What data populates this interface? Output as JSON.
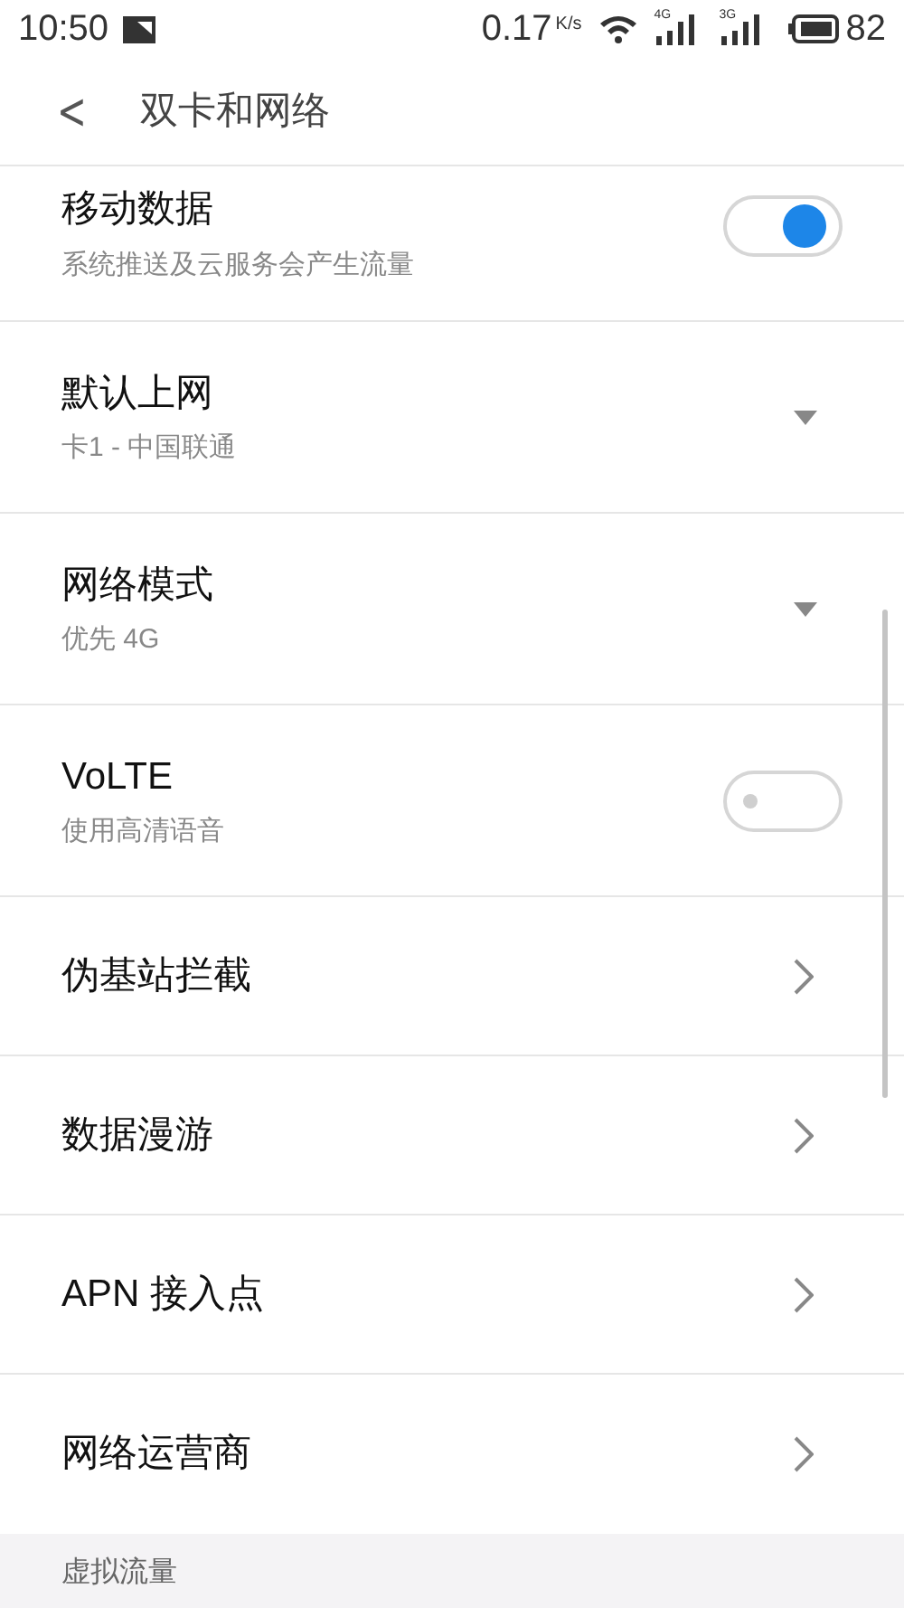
{
  "status_bar": {
    "time": "10:50",
    "speed": "0.17",
    "speed_unit": "K/s",
    "signals": [
      {
        "label": "4G"
      },
      {
        "label": "3G"
      }
    ],
    "battery": "82"
  },
  "header": {
    "back": "<",
    "title": "双卡和网络"
  },
  "settings": [
    {
      "kind": "toggle",
      "title": "移动数据",
      "subtitle": "系统推送及云服务会产生流量",
      "on": true
    },
    {
      "kind": "dropdown",
      "title": "默认上网",
      "subtitle": "卡1 - 中国联通"
    },
    {
      "kind": "dropdown",
      "title": "网络模式",
      "subtitle": "优先 4G"
    },
    {
      "kind": "toggle",
      "title": "VoLTE",
      "subtitle": "使用高清语音",
      "on": false
    },
    {
      "kind": "link",
      "title": "伪基站拦截"
    },
    {
      "kind": "link",
      "title": "数据漫游"
    },
    {
      "kind": "link",
      "title": "APN 接入点"
    },
    {
      "kind": "link",
      "title": "网络运营商"
    }
  ],
  "section_header": "虚拟流量"
}
